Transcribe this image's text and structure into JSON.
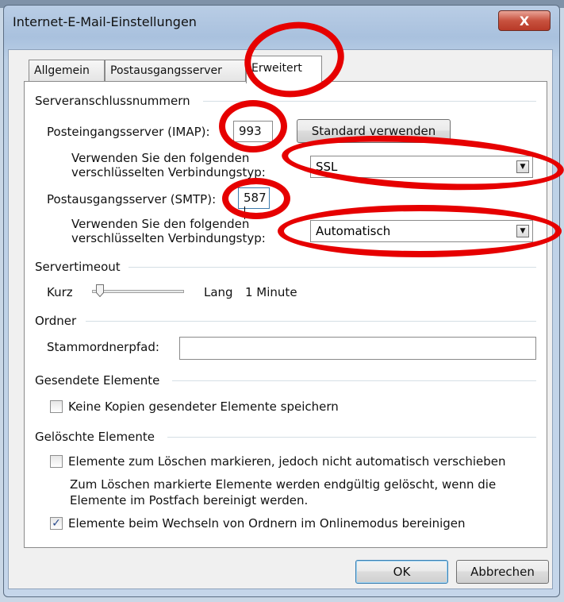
{
  "window": {
    "title": "Internet-E-Mail-Einstellungen",
    "close_glyph": "X"
  },
  "tabs": [
    {
      "label": "Allgemein",
      "active": false
    },
    {
      "label": "Postausgangsserver",
      "active": false
    },
    {
      "label": "Erweitert",
      "active": true
    }
  ],
  "server_ports": {
    "heading": "Serveranschlussnummern",
    "incoming_label": "Posteingangsserver (IMAP):",
    "incoming_value": "993",
    "default_button": "Standard verwenden",
    "enc_label_line1": "Verwenden Sie den folgenden",
    "enc_label_line2": "verschlüsselten Verbindungstyp:",
    "incoming_encryption": "SSL",
    "outgoing_label": "Postausgangsserver (SMTP):",
    "outgoing_value": "587",
    "outgoing_encryption": "Automatisch"
  },
  "timeout": {
    "heading": "Servertimeout",
    "short_label": "Kurz",
    "long_label": "Lang",
    "value_text": "1 Minute",
    "slider_fraction": 0.05
  },
  "folders": {
    "heading": "Ordner",
    "root_label": "Stammordnerpfad:",
    "root_value": ""
  },
  "sent": {
    "heading": "Gesendete Elemente",
    "no_copies_label": "Keine Kopien gesendeter Elemente speichern",
    "no_copies_checked": false
  },
  "deleted": {
    "heading": "Gelöschte Elemente",
    "mark_label": "Elemente zum Löschen markieren, jedoch nicht automatisch verschieben",
    "mark_checked": false,
    "info_line1": "Zum Löschen markierte Elemente werden endgültig gelöscht, wenn die",
    "info_line2": "Elemente im Postfach bereinigt werden.",
    "purge_label": "Elemente beim Wechseln von Ordnern im Onlinemodus bereinigen",
    "purge_checked": true,
    "check_glyph": "✓"
  },
  "buttons": {
    "ok": "OK",
    "cancel": "Abbrechen"
  },
  "annotation_color": "#e60000"
}
